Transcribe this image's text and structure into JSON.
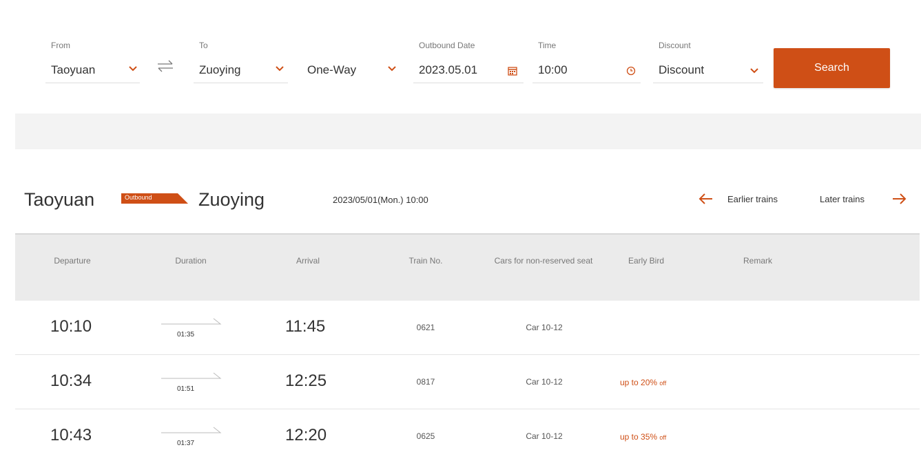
{
  "search": {
    "from": {
      "label": "From",
      "value": "Taoyuan"
    },
    "to": {
      "label": "To",
      "value": "Zuoying"
    },
    "trip_type": {
      "value": "One-Way"
    },
    "outbound_date": {
      "label": "Outbound Date",
      "value": "2023.05.01"
    },
    "time": {
      "label": "Time",
      "value": "10:00"
    },
    "discount": {
      "label": "Discount",
      "value": "Discount"
    },
    "search_label": "Search"
  },
  "route": {
    "from": "Taoyuan",
    "badge": "Outbound",
    "to": "Zuoying",
    "datetime": "2023/05/01(Mon.) 10:00",
    "earlier_label": "Earlier trains",
    "later_label": "Later trains"
  },
  "table": {
    "columns": [
      "Departure",
      "Duration",
      "Arrival",
      "Train No.",
      "Cars for non-reserved seat",
      "Early Bird",
      "Remark"
    ],
    "rows": [
      {
        "departure": "10:10",
        "duration": "01:35",
        "arrival": "11:45",
        "train_no": "0621",
        "cars": "Car 10-12",
        "early_bird": "",
        "early_bird_suffix": ""
      },
      {
        "departure": "10:34",
        "duration": "01:51",
        "arrival": "12:25",
        "train_no": "0817",
        "cars": "Car 10-12",
        "early_bird": "up to 20%",
        "early_bird_suffix": "off"
      },
      {
        "departure": "10:43",
        "duration": "01:37",
        "arrival": "12:20",
        "train_no": "0625",
        "cars": "Car 10-12",
        "early_bird": "up to 35%",
        "early_bird_suffix": "off"
      }
    ]
  },
  "colors": {
    "accent": "#cf4f16",
    "header_bg": "#ebebeb",
    "band_bg": "#f3f3f3"
  },
  "icons": {
    "dropdown": "chevron-down-icon",
    "swap": "swap-arrows-icon",
    "calendar": "calendar-icon",
    "clock": "clock-icon",
    "prev": "arrow-left-icon",
    "next": "arrow-right-icon"
  }
}
